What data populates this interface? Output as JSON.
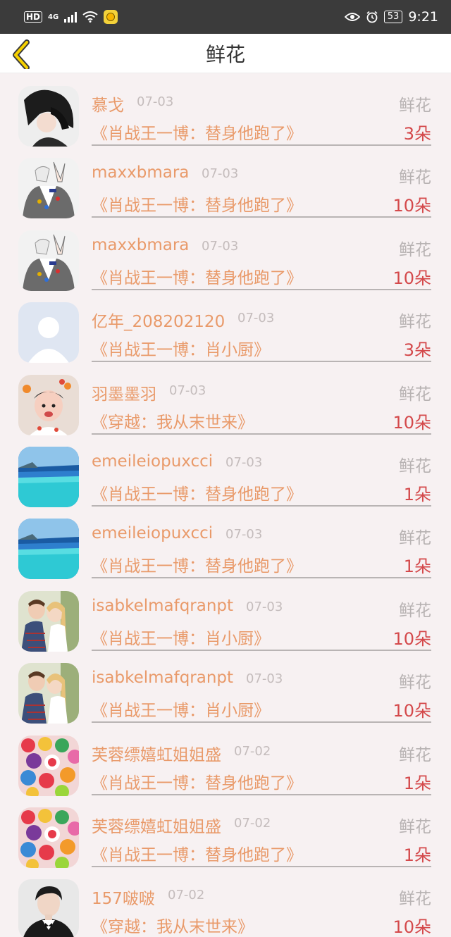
{
  "status_bar": {
    "network": "HD",
    "network_type": "4G",
    "battery": "53",
    "time": "9:21"
  },
  "header": {
    "title": "鲜花"
  },
  "colors": {
    "name": "#e99a6a",
    "count": "#d4494b",
    "gift": "#b7b2b2"
  },
  "records": [
    {
      "avatar": "anime-couple",
      "name": "慕戈",
      "date": "07-03",
      "gift": "鲜花",
      "book": "《肖战王一博：替身他跑了》",
      "count": "3朵"
    },
    {
      "avatar": "anime-peace-sign",
      "name": "maxxbmara",
      "date": "07-03",
      "gift": "鲜花",
      "book": "《肖战王一博：替身他跑了》",
      "count": "10朵"
    },
    {
      "avatar": "anime-peace-sign",
      "name": "maxxbmara",
      "date": "07-03",
      "gift": "鲜花",
      "book": "《肖战王一博：替身他跑了》",
      "count": "10朵"
    },
    {
      "avatar": "default-user",
      "name": "亿年_208202120",
      "date": "07-03",
      "gift": "鲜花",
      "book": "《肖战王一博：肖小厨》",
      "count": "3朵"
    },
    {
      "avatar": "baby-photo",
      "name": "羽墨墨羽",
      "date": "07-03",
      "gift": "鲜花",
      "book": "《穿越：我从末世来》",
      "count": "10朵"
    },
    {
      "avatar": "pool-seascape",
      "name": "emeileiopuxcci",
      "date": "07-03",
      "gift": "鲜花",
      "book": "《肖战王一博：替身他跑了》",
      "count": "1朵"
    },
    {
      "avatar": "pool-seascape",
      "name": "emeileiopuxcci",
      "date": "07-03",
      "gift": "鲜花",
      "book": "《肖战王一博：替身他跑了》",
      "count": "1朵"
    },
    {
      "avatar": "couple-kiss",
      "name": "isabkelmafqranpt",
      "date": "07-03",
      "gift": "鲜花",
      "book": "《肖战王一博：肖小厨》",
      "count": "10朵"
    },
    {
      "avatar": "couple-kiss",
      "name": "isabkelmafqranpt",
      "date": "07-03",
      "gift": "鲜花",
      "book": "《肖战王一博：肖小厨》",
      "count": "10朵"
    },
    {
      "avatar": "candy-pile",
      "name": "芙蓉缥嬉虹姐姐盛",
      "date": "07-02",
      "gift": "鲜花",
      "book": "《肖战王一博：替身他跑了》",
      "count": "1朵"
    },
    {
      "avatar": "candy-pile",
      "name": "芙蓉缥嬉虹姐姐盛",
      "date": "07-02",
      "gift": "鲜花",
      "book": "《肖战王一博：替身他跑了》",
      "count": "1朵"
    },
    {
      "avatar": "man-in-suit",
      "name": "157啵啵",
      "date": "07-02",
      "gift": "鲜花",
      "book": "《穿越：我从末世来》",
      "count": "10朵"
    }
  ]
}
